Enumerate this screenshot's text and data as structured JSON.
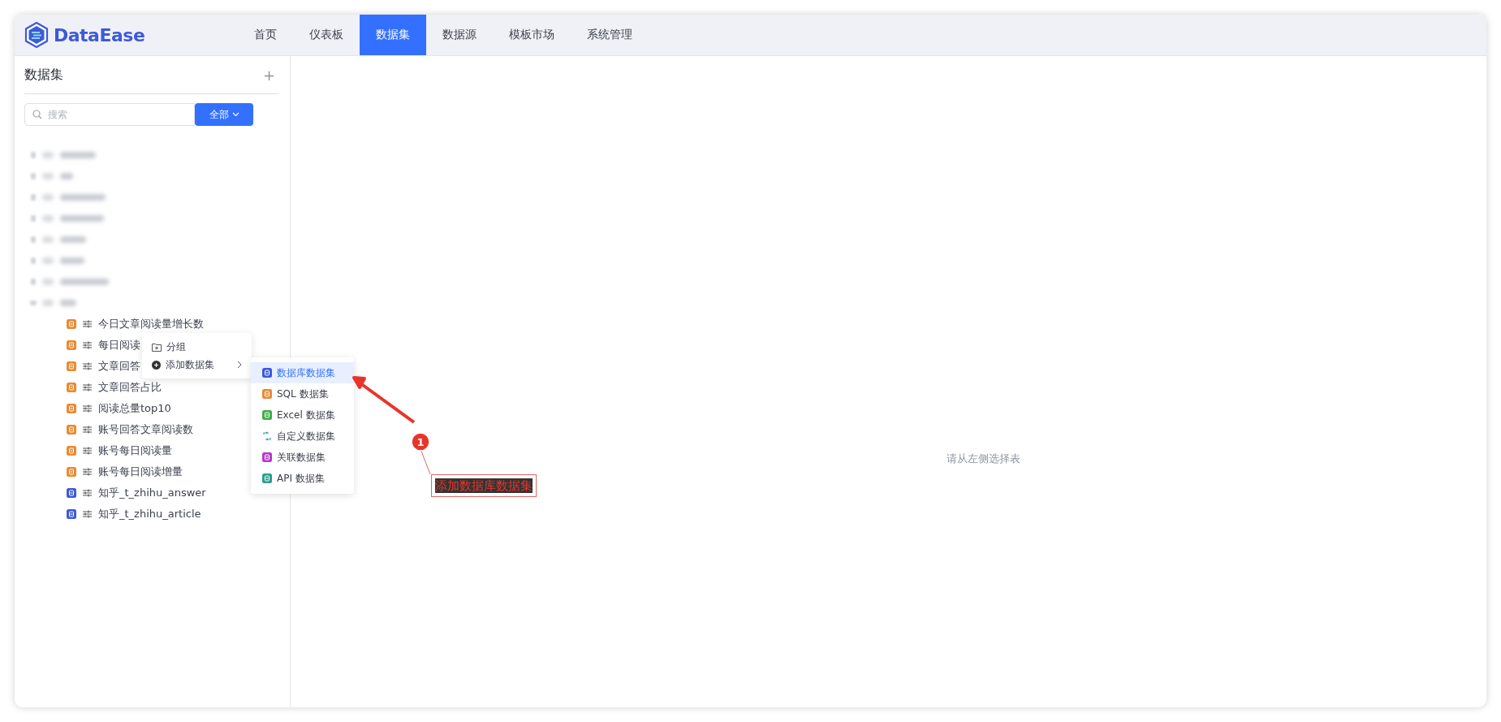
{
  "app": {
    "logo": "DataEase"
  },
  "nav": [
    {
      "label": "首页",
      "selected": false
    },
    {
      "label": "仪表板",
      "selected": false
    },
    {
      "label": "数据集",
      "selected": true
    },
    {
      "label": "数据源",
      "selected": false
    },
    {
      "label": "模板市场",
      "selected": false
    },
    {
      "label": "系统管理",
      "selected": false
    }
  ],
  "sidebar": {
    "title": "数据集",
    "add_icon": "+",
    "search": {
      "placeholder": "搜索"
    },
    "filter_button": "全部"
  },
  "tree": [
    {
      "kind": "redacted",
      "expanded": false
    },
    {
      "kind": "redacted",
      "expanded": false
    },
    {
      "kind": "redacted",
      "expanded": false
    },
    {
      "kind": "redacted",
      "expanded": false
    },
    {
      "kind": "redacted",
      "expanded": false
    },
    {
      "kind": "redacted",
      "expanded": false
    },
    {
      "kind": "redacted",
      "expanded": false
    },
    {
      "kind": "redacted",
      "expanded": true,
      "children": [
        {
          "kind": "sql",
          "label": "今日文章阅读量增长数"
        },
        {
          "kind": "sql",
          "label": "每日阅读"
        },
        {
          "kind": "sql",
          "label": "文章回答"
        },
        {
          "kind": "sql",
          "label": "文章回答占比"
        },
        {
          "kind": "sql",
          "label": "阅读总量top10"
        },
        {
          "kind": "sql",
          "label": "账号回答文章阅读数"
        },
        {
          "kind": "sql",
          "label": "账号每日阅读量"
        },
        {
          "kind": "sql",
          "label": "账号每日阅读增量"
        },
        {
          "kind": "database",
          "label": "知乎_t_zhihu_answer"
        },
        {
          "kind": "database",
          "label": "知乎_t_zhihu_article"
        }
      ]
    }
  ],
  "context_menu": [
    {
      "kind": "folder",
      "label": "分组",
      "has_submenu": false
    },
    {
      "kind": "add",
      "label": "添加数据集",
      "has_submenu": true
    }
  ],
  "submenu": [
    {
      "kind": "database",
      "label": "数据库数据集",
      "selected": true
    },
    {
      "kind": "sql",
      "label": "SQL 数据集",
      "selected": false
    },
    {
      "kind": "excel",
      "label": "Excel 数据集",
      "selected": false
    },
    {
      "kind": "custom",
      "label": "自定义数据集",
      "selected": false
    },
    {
      "kind": "union",
      "label": "关联数据集",
      "selected": false
    },
    {
      "kind": "api",
      "label": "API 数据集",
      "selected": false
    }
  ],
  "annotation": {
    "badge": "1",
    "label": "添加数据库数据集"
  },
  "main": {
    "empty_text": "请从左侧选择表"
  }
}
